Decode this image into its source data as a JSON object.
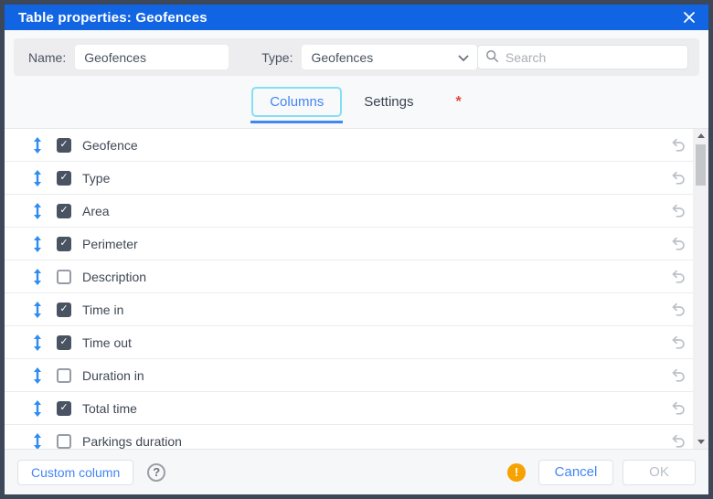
{
  "dialog": {
    "title": "Table properties: Geofences"
  },
  "header": {
    "name_label": "Name:",
    "name_value": "Geofences",
    "type_label": "Type:",
    "type_value": "Geofences",
    "search_placeholder": "Search"
  },
  "tabs": {
    "columns_label": "Columns",
    "settings_label": "Settings",
    "required_marker": "*"
  },
  "columns": [
    {
      "label": "Geofence",
      "checked": true
    },
    {
      "label": "Type",
      "checked": true
    },
    {
      "label": "Area",
      "checked": true
    },
    {
      "label": "Perimeter",
      "checked": true
    },
    {
      "label": "Description",
      "checked": false
    },
    {
      "label": "Time in",
      "checked": true
    },
    {
      "label": "Time out",
      "checked": true
    },
    {
      "label": "Duration in",
      "checked": false
    },
    {
      "label": "Total time",
      "checked": true
    },
    {
      "label": "Parkings duration",
      "checked": false
    }
  ],
  "footer": {
    "custom_column_label": "Custom column",
    "help_icon": "?",
    "warning_icon": "!",
    "cancel_label": "Cancel",
    "ok_label": "OK"
  },
  "icons": {
    "check_mark": "✓"
  },
  "colors": {
    "accent": "#1165e3",
    "link": "#4286f5",
    "frame": "#3c4859",
    "content-bg": "#f8f9fa",
    "checkbox": "#4a5362",
    "drag": "#2e8cf0",
    "warning": "#f6a200",
    "danger": "#e8453c"
  }
}
